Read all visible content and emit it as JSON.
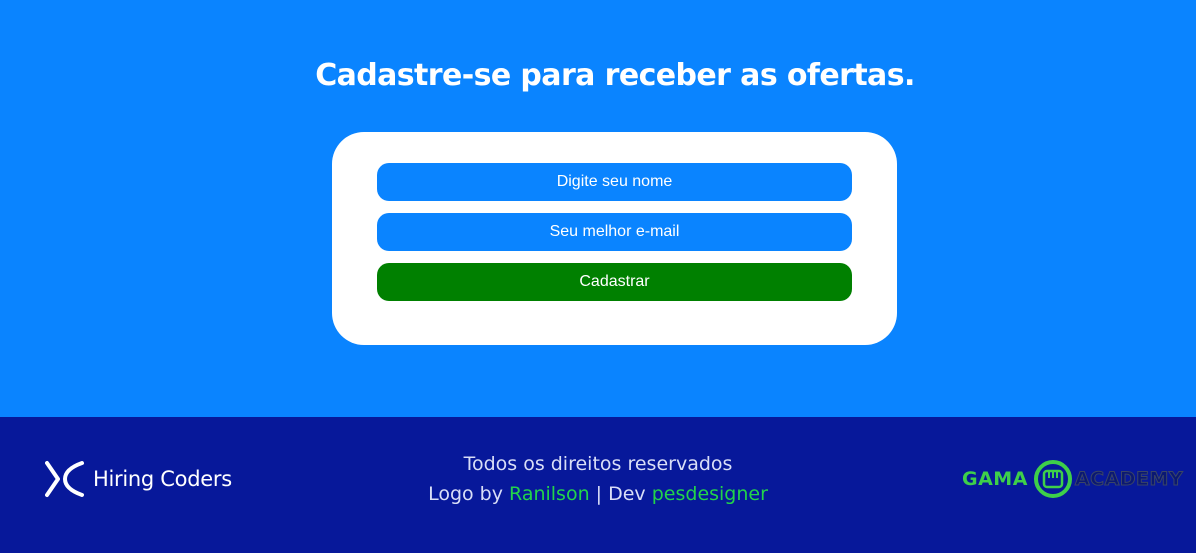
{
  "signup": {
    "heading": "Cadastre-se para receber as ofertas.",
    "name_placeholder": "Digite seu nome",
    "email_placeholder": "Seu melhor e-mail",
    "submit_label": "Cadastrar"
  },
  "footer": {
    "brand_name": "Hiring Coders",
    "rights": "Todos os direitos reservados",
    "logo_by_prefix": "Logo by",
    "logo_author": "Ranilson",
    "separator": "| Dev",
    "dev_author": "pesdesigner",
    "partner_word_1": "GAMA",
    "partner_word_2": "ACADEMY"
  },
  "colors": {
    "primary": "#0a84ff",
    "footer_bg": "#07189a",
    "submit": "#008000",
    "link": "#22d44a"
  }
}
